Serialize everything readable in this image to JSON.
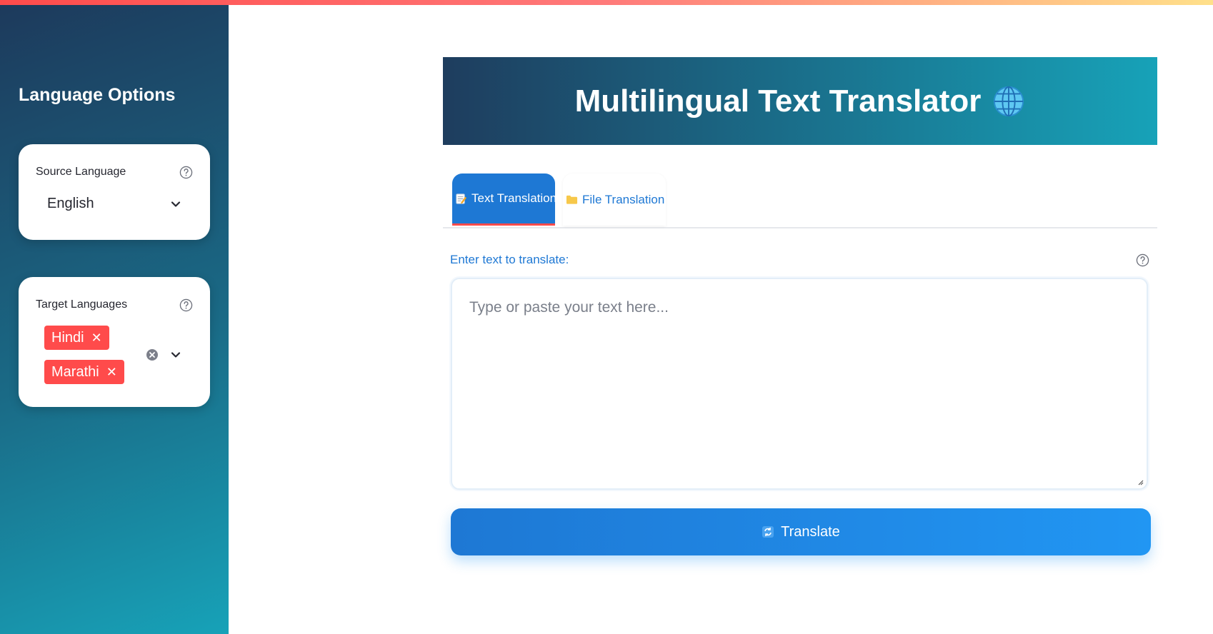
{
  "sidebar": {
    "title": "Language Options",
    "source": {
      "label": "Source Language",
      "value": "English"
    },
    "target": {
      "label": "Target Languages",
      "tags": [
        "Hindi",
        "Marathi"
      ],
      "remove_glyph": "✕"
    }
  },
  "header": {
    "title": "Multilingual Text Translator",
    "icon": "globe-icon"
  },
  "tabs": [
    {
      "label": "Text Translation",
      "icon": "memo-icon",
      "active": true
    },
    {
      "label": "File Translation",
      "icon": "folder-icon",
      "active": false
    }
  ],
  "main": {
    "input_label": "Enter text to translate:",
    "placeholder": "Type or paste your text here...",
    "button_label": "Translate",
    "button_icon": "refresh-icon"
  },
  "colors": {
    "accent": "#1e78d4",
    "tag": "#ff4b4b",
    "sidebar_start": "#1d3a5c",
    "sidebar_end": "#17a2b8"
  }
}
